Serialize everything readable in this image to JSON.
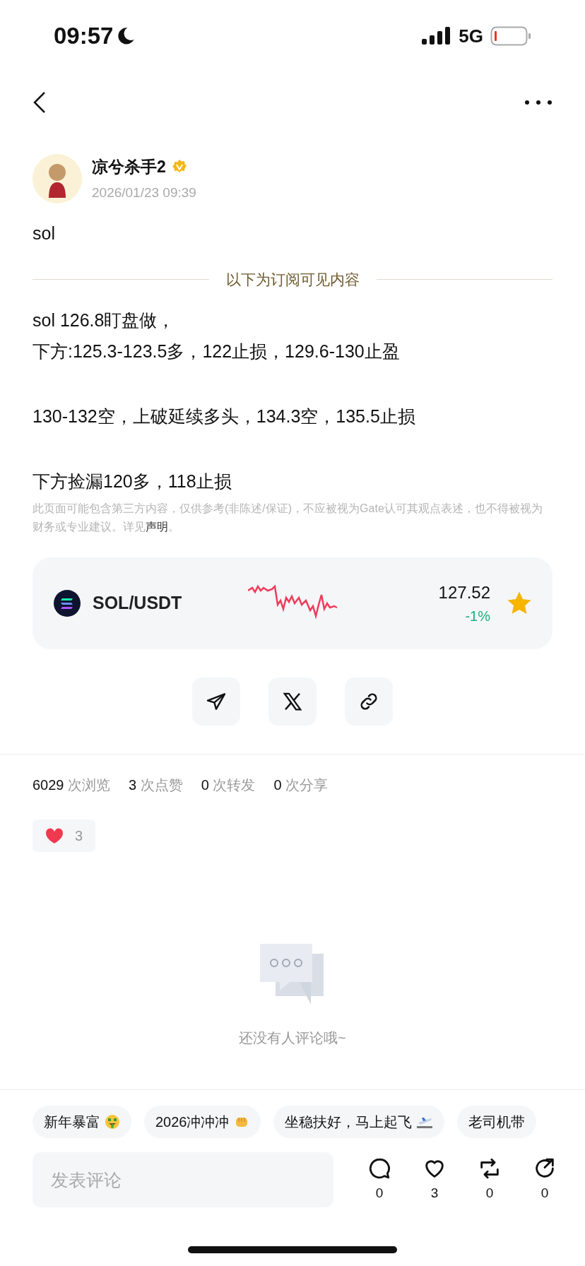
{
  "status_bar": {
    "time": "09:57",
    "network": "5G"
  },
  "author": {
    "name": "凉兮杀手2",
    "verified": true,
    "date": "2026/01/23 09:39"
  },
  "title": "sol",
  "paywall_divider": "以下为订阅可见内容",
  "paragraphs": [
    {
      "lines": [
        "sol 126.8盯盘做，",
        "下方:125.3-123.5多，122止损，129.6-130止盈"
      ]
    },
    {
      "lines": [
        "130-132空，上破延续多头，134.3空，135.5止损"
      ]
    },
    {
      "lines": [
        "下方捡漏120多，118止损"
      ]
    }
  ],
  "disclaimer": {
    "text": "此页面可能包含第三方内容，仅供参考(非陈述/保证)，不应被视为Gate认可其观点表述，也不得被视为财务或专业建议。详见",
    "link": "声明",
    "end": "。"
  },
  "ticker": {
    "pair": "SOL/USDT",
    "price": "127.52",
    "change": "-1%",
    "favorited": true
  },
  "share_buttons": [
    {
      "kind": "telegram"
    },
    {
      "kind": "x"
    },
    {
      "kind": "link"
    }
  ],
  "stats": [
    {
      "count": "6029",
      "unit": "次浏览"
    },
    {
      "count": "3",
      "unit": "次点赞"
    },
    {
      "count": "0",
      "unit": "次转发"
    },
    {
      "count": "0",
      "unit": "次分享"
    }
  ],
  "reaction": {
    "count": "3"
  },
  "empty_comments": "还没有人评论哦~",
  "quick_replies": [
    {
      "text": "新年暴富",
      "kind": "money"
    },
    {
      "text": "2026冲冲冲",
      "kind": "fist"
    },
    {
      "text": "坐稳扶好，马上起飞",
      "kind": "plane"
    },
    {
      "text": "老司机带"
    }
  ],
  "comment_input": {
    "placeholder": "发表评论"
  },
  "actions": [
    {
      "kind": "comment",
      "count": "0"
    },
    {
      "kind": "like",
      "count": "3"
    },
    {
      "kind": "repost",
      "count": "0"
    },
    {
      "kind": "share",
      "count": "0"
    }
  ]
}
